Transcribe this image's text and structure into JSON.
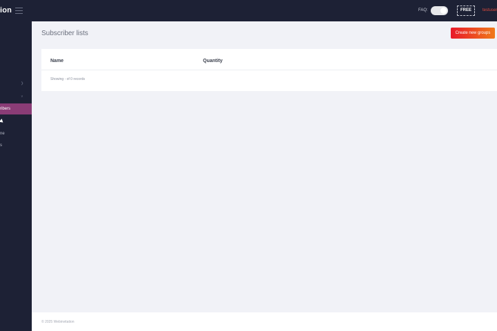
{
  "app": {
    "brand": "ion",
    "faq_label": "FAQ:",
    "plan": "FREE",
    "user": "testuser"
  },
  "sidebar": {
    "items": [
      {
        "label": "ribers",
        "active": true
      },
      {
        "label": "ne",
        "active": false
      },
      {
        "label": "s",
        "active": false
      }
    ]
  },
  "page": {
    "title": "Subscriber lists",
    "create_button": "Create new groups"
  },
  "table": {
    "columns": [
      "Name",
      "Quantity"
    ],
    "records_text": "Showing - of 0 records"
  },
  "footer": {
    "text": "© 2025 Webinvitation"
  },
  "colors": {
    "topbar": "#1d2135",
    "sidebar_active": "#8a3c76",
    "button_gradient_start": "#e8192a",
    "button_gradient_end": "#f07a1a",
    "user_name": "#e04a3b"
  }
}
